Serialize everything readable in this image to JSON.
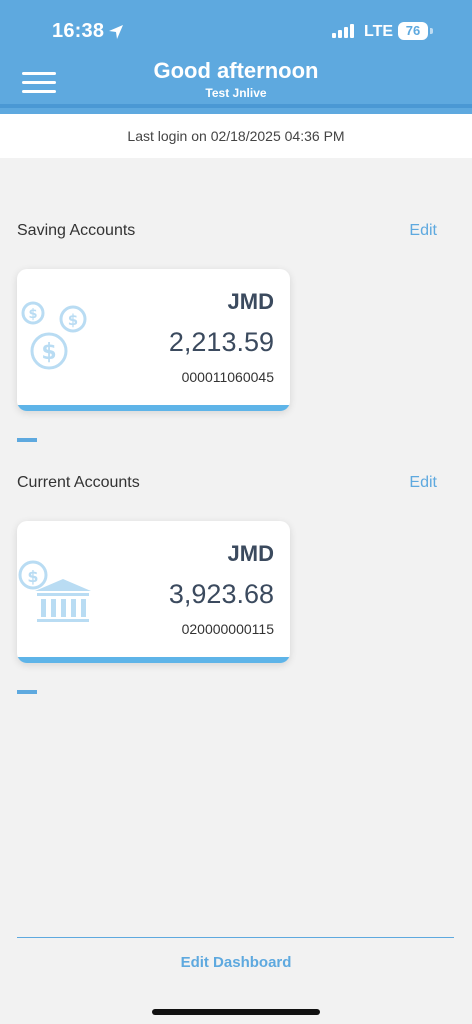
{
  "status_bar": {
    "time": "16:38",
    "network": "LTE",
    "battery": "76"
  },
  "header": {
    "greeting": "Good afternoon",
    "user_name": "Test Jnlive"
  },
  "last_login": "Last login on 02/18/2025 04:36 PM",
  "saving_accounts": {
    "title": "Saving Accounts",
    "edit_label": "Edit",
    "cards": [
      {
        "currency": "JMD",
        "balance": "2,213.59",
        "account_number": "000011060045",
        "icon": "coins-icon"
      }
    ]
  },
  "current_accounts": {
    "title": "Current Accounts",
    "edit_label": "Edit",
    "cards": [
      {
        "currency": "JMD",
        "balance": "3,923.68",
        "account_number": "020000000115",
        "icon": "bank-icon"
      }
    ]
  },
  "footer": {
    "edit_dashboard_label": "Edit Dashboard"
  },
  "colors": {
    "primary": "#5ea9df",
    "card_accent": "#5eb4e8",
    "text_dark": "#3b4a5e"
  }
}
